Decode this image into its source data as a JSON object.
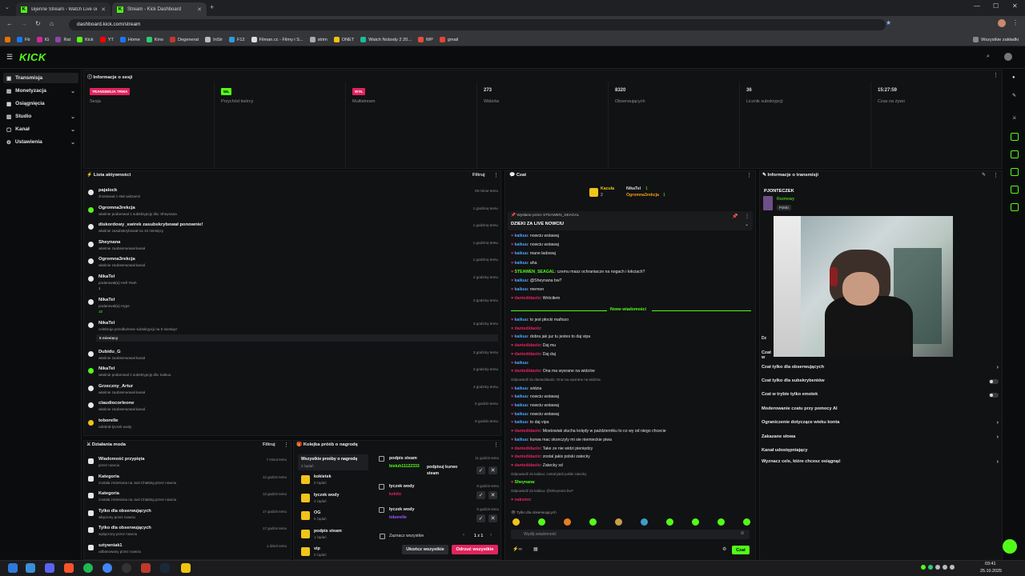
{
  "browser": {
    "tabs": [
      {
        "title": "siljenne Stream - Watch Live on"
      },
      {
        "title": "Stream - Kick Dashboard"
      }
    ],
    "url": "dashboard.kick.com/stream",
    "bookmarks": [
      "Fb",
      "IG",
      "Rat",
      "Kick",
      "YT",
      "Home",
      "Kino",
      "Degenerat",
      "InStr",
      "F12",
      "Filman.cc - Filmy i S...",
      "strim",
      "ONET",
      "Watch Nobody 2 20...",
      "WP",
      "gmail"
    ],
    "all_bookmarks": "Wszystkie zakładki"
  },
  "app": {
    "logo": "KICK"
  },
  "sidebar": {
    "items": [
      {
        "label": "Transmisja",
        "chevron": false
      },
      {
        "label": "Monetyzacja",
        "chevron": true
      },
      {
        "label": "Osiągnięcia",
        "chevron": false
      },
      {
        "label": "Studio",
        "chevron": true
      },
      {
        "label": "Kanał",
        "chevron": true
      },
      {
        "label": "Ustawienia",
        "chevron": true
      }
    ]
  },
  "session": {
    "title": "Informacje o sesji",
    "stats": [
      {
        "value": "TRANSMISJA TRWA",
        "label": "Sesja",
        "kind": "badge-red"
      },
      {
        "value": "WŁ",
        "label": "Przychód twórcy",
        "kind": "badge-green"
      },
      {
        "value": "WYŁ",
        "label": "Multistream",
        "kind": "badge-red"
      },
      {
        "value": "273",
        "label": "Widzów",
        "kind": "text"
      },
      {
        "value": "8320",
        "label": "Obserwujących",
        "kind": "text"
      },
      {
        "value": "36",
        "label": "Licznik subskrypcji",
        "kind": "text"
      },
      {
        "value": "15:27:59",
        "label": "Czas na żywo",
        "kind": "text"
      }
    ]
  },
  "activity": {
    "title": "Lista aktywności",
    "filter": "Filtruj",
    "items": [
      {
        "name": "pajalock",
        "desc": "zhostował z 456 widzami!",
        "time": "29 minut temu",
        "color": "#e8e8e8"
      },
      {
        "name": "Ogromna3rekcja",
        "desc": "właśnie podarował 1 subskrypcję dla: Sheynana",
        "time": "1 godzinę temu",
        "color": "#53fc18"
      },
      {
        "name": "diskordowy_swirek zasubskrybował ponownie!",
        "desc": "właśnie zasubskrybował na 10 miesięcy",
        "time": "1 godzinę temu",
        "color": "#e8e8e8"
      },
      {
        "name": "Sheynana",
        "desc": "właśnie zaobserwował kanał",
        "time": "1 godzinę temu",
        "color": "#e8e8e8"
      },
      {
        "name": "Ogromna3rekcja",
        "desc": "właśnie zaobserwował kanał",
        "time": "1 godzinę temu",
        "color": "#e8e8e8"
      },
      {
        "name": "NikaTel",
        "desc": "podarował(a) Hell Yeah",
        "extra": "1",
        "time": "2 godziny temu",
        "color": "#e8e8e8"
      },
      {
        "name": "NikaTel",
        "desc": "podarował(a) Hype",
        "extra": "10",
        "time": "2 godziny temu",
        "color": "#e8e8e8"
      },
      {
        "name": "NikaTel",
        "desc": "celebruje przedłużenie subskrypcji na 5 miesiąc!",
        "extra": "5 miesięcy",
        "time": "3 godziny temu",
        "color": "#e8e8e8"
      },
      {
        "name": "Dubidu_G",
        "desc": "właśnie zaobserwował kanał",
        "time": "3 godziny temu",
        "color": "#e8e8e8"
      },
      {
        "name": "NikaTel",
        "desc": "właśnie podarował 1 subskrypcję dla: kaikuu",
        "time": "3 godziny temu",
        "color": "#53fc18"
      },
      {
        "name": "Grzeczny_Artur",
        "desc": "właśnie zaobserwował kanał",
        "time": "4 godziny temu",
        "color": "#e8e8e8"
      },
      {
        "name": "claudiocorleone",
        "desc": "właśnie zaobserwował kanał",
        "time": "5 godzin temu",
        "color": "#e8e8e8"
      },
      {
        "name": "toborelle",
        "desc": "odebrał łyczek wody",
        "time": "8 godzin temu",
        "color": "#f0c419"
      }
    ]
  },
  "chat": {
    "title": "Czat",
    "top": {
      "name1": "Kacula",
      "n1": "2",
      "name2": "NikaTel",
      "n2": "1",
      "name3": "Ogromna3rekcja",
      "n3": "1"
    },
    "pinned_by": "Wysłane przez STEAWEN_SEAGAL",
    "pinned_text": "DZIEKI ZA LIVE NOWCIU",
    "lines": [
      {
        "user": "kaikuu",
        "text": "nowciu wstawaj",
        "cls": "u"
      },
      {
        "user": "kaikuu",
        "text": "nowciu wstawaj",
        "cls": "u"
      },
      {
        "user": "kaikuu",
        "text": "mane ładowaj",
        "cls": "u"
      },
      {
        "user": "kaikuu",
        "text": "aha",
        "cls": "u"
      },
      {
        "user": "STEAWEN_SEAGAL",
        "text": "czemu masz ochraniacze na nogach i łokciach?",
        "cls": "u3"
      },
      {
        "user": "kaikuu",
        "text": "@Sheynana bw?",
        "cls": "u"
      },
      {
        "user": "kaikuu",
        "text": "memon",
        "cls": "u"
      },
      {
        "user": "dantedidaolo",
        "text": "Wróciłem",
        "cls": "u2"
      }
    ],
    "new_messages": "Nowe wiadomości",
    "lines2": [
      {
        "user": "kaikuu",
        "text": "to jest płocki mafiozo",
        "cls": "u"
      },
      {
        "user": "dantedidaolo",
        "text": "",
        "cls": "u2"
      },
      {
        "user": "kaikuu",
        "text": "dobra jak juz tu jestes to daj vipa",
        "cls": "u"
      },
      {
        "user": "dantedidaolo",
        "text": "Daj mu",
        "cls": "u2"
      },
      {
        "user": "dantedidaolo",
        "text": "Daj daj",
        "cls": "u2"
      },
      {
        "user": "kaikuu",
        "text": "",
        "cls": "u"
      },
      {
        "user": "dantedidaolo",
        "text": "Ona ma wysrane na widzów",
        "cls": "u2"
      },
      {
        "user": "",
        "text": "Odpowiedź do dantedidaolo: Ona ma wysrane na widzów",
        "cls": "muted"
      },
      {
        "user": "kaikuu",
        "text": "widzia",
        "cls": "u"
      },
      {
        "user": "kaikuu",
        "text": "nowciu wstawaj",
        "cls": "u"
      },
      {
        "user": "kaikuu",
        "text": "nowciu wstawaj",
        "cls": "u"
      },
      {
        "user": "kaikuu",
        "text": "nowciu wstawaj",
        "cls": "u"
      },
      {
        "user": "kaikuu",
        "text": "to daj vipa",
        "cls": "u"
      },
      {
        "user": "dantedidaolo",
        "text": "Mostowiak słucha kolędy w październiku to co wy od niego chcecie",
        "cls": "u2"
      },
      {
        "user": "kaikuu",
        "text": "kurwa mac skonczyly mi sie niemieckie piwa",
        "cls": "u"
      },
      {
        "user": "dantedidaolo",
        "text": "Take ze nie widzi pieniędzy",
        "cls": "u2"
      },
      {
        "user": "dantedidaolo",
        "text": "zostal jakis polski zatecky",
        "cls": "u2"
      },
      {
        "user": "dantedidaolo",
        "text": "Zatecky xd",
        "cls": "u2"
      },
      {
        "user": "",
        "text": "Odpowiedź do kaikuu: został jakiś polski zatecky",
        "cls": "muted"
      },
      {
        "user": "Sheynana",
        "text": "",
        "cls": "u3"
      },
      {
        "user": "",
        "text": "Odpowiedź do kaikuu: @Sheynana bw?",
        "cls": "muted"
      },
      {
        "user": "naksino",
        "text": "",
        "cls": "u2"
      }
    ],
    "followers_only": "Tylko dla obserwujących",
    "input_placeholder": "Wyślij wiadomość",
    "send": "Czat"
  },
  "stream_info": {
    "title": "Informacje o transmisji",
    "channel": "PJONTECZEK",
    "category": "Rozmowy",
    "language": "Polski"
  },
  "chat_settings": [
    {
      "label": "Czat tylko dla obserwujących",
      "type": "arrow"
    },
    {
      "label": "Czat tylko dla subskrybentów",
      "type": "toggle"
    },
    {
      "label": "Czat w trybie tylko emotek",
      "type": "toggle"
    },
    {
      "label": "Moderowanie czatu przy pomocy AI",
      "type": "none"
    },
    {
      "label": "Ograniczenie dotyczące wieku konta",
      "type": "arrow"
    },
    {
      "label": "Zakazane słowa",
      "type": "arrow"
    },
    {
      "label": "Kanał udostępniający",
      "type": "none"
    },
    {
      "label": "Wyznacz cele, które chcesz osiągnąć",
      "type": "arrow"
    }
  ],
  "mod_actions": {
    "title": "Działania moda",
    "filter": "Filtruj",
    "items": [
      {
        "name": "Wiadomość przypięta",
        "desc": "przez nowciu",
        "time": "7 minut temu"
      },
      {
        "name": "Kategoria",
        "desc": "została zmieniona na Just Chatting przez nowciu",
        "time": "12 godzin temu"
      },
      {
        "name": "Kategoria",
        "desc": "została zmieniona na Just Chatting przez nowciu",
        "time": "13 godzin temu"
      },
      {
        "name": "Tylko dla obserwujących",
        "desc": "włączony przez nowciu",
        "time": "17 godzin temu"
      },
      {
        "name": "Tylko dla obserwujących",
        "desc": "wyłączony przez nowciu",
        "time": "17 godzin temu"
      },
      {
        "name": "sztywniak1",
        "desc": "odbanowany przez nowciu",
        "time": "1 dzień temu"
      }
    ]
  },
  "rewards": {
    "title": "Kolejka próśb o nagrodę",
    "all": "Wszystkie prośby o nagrodę",
    "all_count": "3 żądań",
    "items": [
      {
        "name": "kokietek",
        "count": "0 żądań"
      },
      {
        "name": "łyczek wody",
        "count": "2 żądań"
      },
      {
        "name": "OG",
        "count": "0 żądań"
      },
      {
        "name": "podpis steam",
        "count": "1 żądań"
      },
      {
        "name": "vip",
        "count": "0 żądań"
      }
    ],
    "requests": [
      {
        "title": "podpis steam",
        "time": "11 godzin temu",
        "user": "bieluh11122333",
        "msg": "podpisuj kurwo steam",
        "ucolor": "#53fc18"
      },
      {
        "title": "łyczek wody",
        "time": "8 godzin temu",
        "user": "kekito",
        "msg": "",
        "ucolor": "#e0245e"
      },
      {
        "title": "łyczek wody",
        "time": "6 godzin temu",
        "user": "toborelle",
        "msg": "",
        "ucolor": "#9b59ff"
      }
    ],
    "select_all": "Zaznacz wszystkie",
    "pager": "1 z 1",
    "finish_all": "Ukończ wszystkie",
    "reject_all": "Odrzuć wszystkie"
  },
  "taskbar": {
    "time": "03:41",
    "date": "25.10.2025"
  },
  "colors": {
    "accent": "#53fc18",
    "red": "#e0245e",
    "bg": "#0b0c0d",
    "panel": "#111214"
  }
}
